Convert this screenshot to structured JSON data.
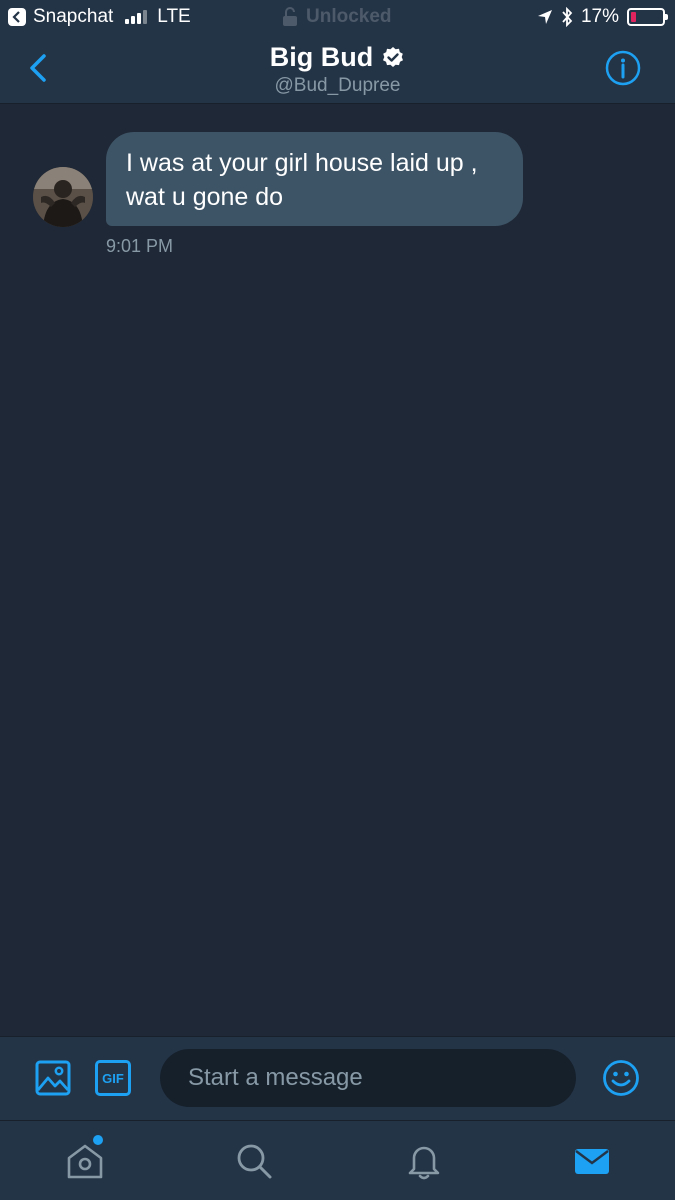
{
  "status_bar": {
    "back_app": "Snapchat",
    "carrier": "LTE",
    "lock_text": "Unlocked",
    "battery": "17%",
    "battery_level": 0.17
  },
  "header": {
    "name": "Big Bud",
    "handle": "@Bud_Dupree",
    "accent": "#1da1f2"
  },
  "conversation": {
    "messages": [
      {
        "text": "I was at your girl house laid up , wat u gone do",
        "time": "9:01 PM"
      }
    ]
  },
  "composer": {
    "gif_label": "GIF",
    "placeholder": "Start a message"
  },
  "tabs": [
    "home",
    "search",
    "notifications",
    "messages"
  ],
  "colors": {
    "background": "#1f2836",
    "bar": "#243447",
    "bubble": "#3d5466",
    "secondary_text": "#8899a6",
    "battery_low": "#e0245e"
  }
}
